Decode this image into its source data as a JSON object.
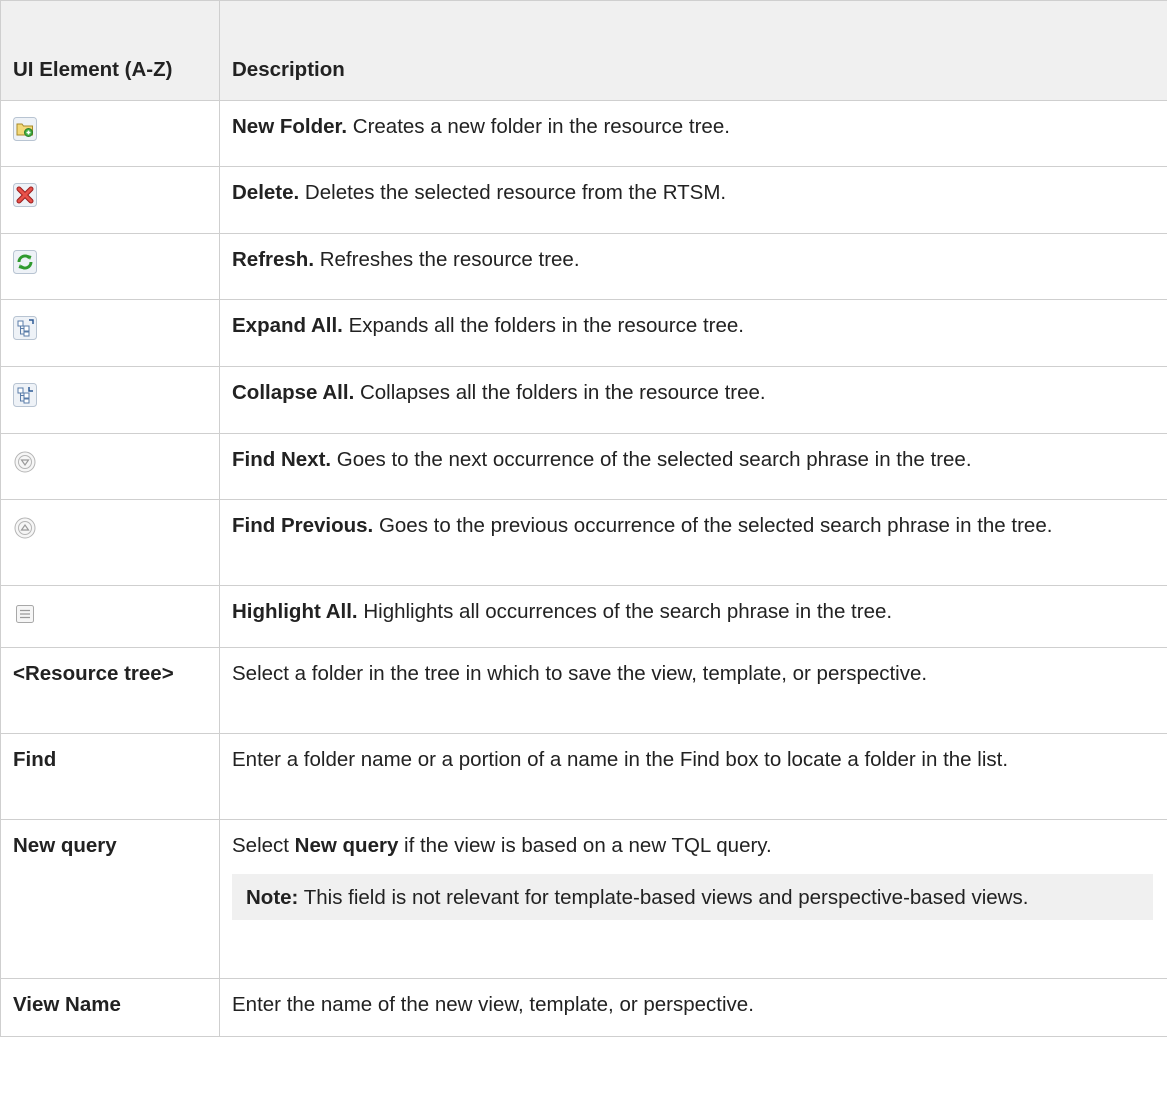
{
  "header": {
    "col1": "UI Element (A-Z)",
    "col2": "Description"
  },
  "rows": [
    {
      "icon": "new-folder-icon",
      "title": "New Folder.",
      "text": " Creates a new folder in the resource tree."
    },
    {
      "icon": "delete-icon",
      "title": "Delete.",
      "text": " Deletes the selected resource from the RTSM."
    },
    {
      "icon": "refresh-icon",
      "title": "Refresh.",
      "text": " Refreshes the resource tree."
    },
    {
      "icon": "expand-all-icon",
      "title": "Expand All.",
      "text": " Expands all the folders in the resource tree."
    },
    {
      "icon": "collapse-all-icon",
      "title": "Collapse All.",
      "text": " Collapses all the folders in the resource tree."
    },
    {
      "icon": "find-next-icon",
      "title": "Find Next.",
      "text": " Goes to the next occurrence of the selected search phrase in the tree."
    },
    {
      "icon": "find-previous-icon",
      "title": "Find Previous.",
      "text": " Goes to the previous occurrence of the selected search phrase in the tree."
    },
    {
      "icon": "highlight-all-icon",
      "title": "Highlight All.",
      "text": " Highlights all occurrences of the search phrase in the tree."
    }
  ],
  "resource_tree": {
    "label": "<Resource tree>",
    "text": "Select a folder in the tree in which to save the view, template, or perspective."
  },
  "find": {
    "label": "Find",
    "text": "Enter a folder name or a portion of a name in the Find box to locate a folder in the list."
  },
  "new_query": {
    "label": "New query",
    "pre": "Select ",
    "bold": "New query",
    "post": " if the view is based on a new TQL query.",
    "note_label": "Note:",
    "note_text": " This field is not relevant for template-based views and perspective-based views."
  },
  "view_name": {
    "label": "View Name",
    "text": "Enter the name of the new view, template, or perspective."
  }
}
